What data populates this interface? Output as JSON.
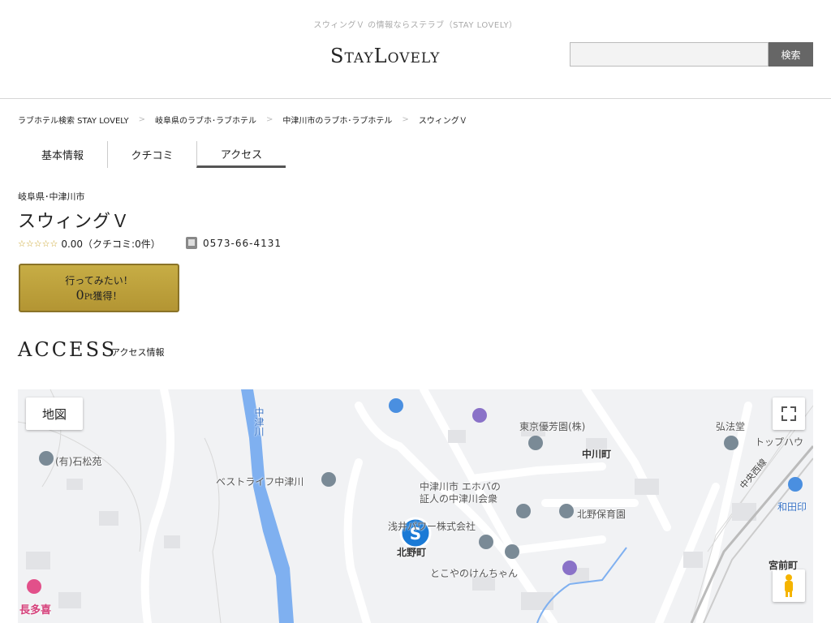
{
  "header": {
    "tagline": "スウィングＶ の情報ならステラブ（STAY LOVELY）",
    "logo": "StayLovely",
    "search_placeholder": "",
    "search_button": "検索"
  },
  "breadcrumb": [
    "ラブホテル検索 STAY LOVELY",
    "岐阜県のラブホ･ラブホテル",
    "中津川市のラブホ･ラブホテル",
    "スウィングＶ"
  ],
  "breadcrumb_separator": ">",
  "tabs": [
    "基本情報",
    "クチコミ",
    "アクセス"
  ],
  "active_tab": "アクセス",
  "hotel": {
    "region": "岐阜県･中津川市",
    "name": "スウィングＶ",
    "stars": "☆☆☆☆☆",
    "rating_text": "0.00（クチコミ:0件）",
    "phone": "0573-66-4131"
  },
  "want_button": {
    "line1": "行ってみたい！",
    "line2_prefix": "0",
    "line2_unit": "Pt",
    "line2_suffix": "獲得！"
  },
  "access": {
    "title": "ACCESS",
    "subtitle": "アクセス情報"
  },
  "map": {
    "type_button": "地図",
    "labels": {
      "ishimatsuen": "(有)石松苑",
      "bestlife": "ベストライフ中津川",
      "tokyo": "東京優芳園(株)",
      "nakagawa": "中川町",
      "kobodo": "弘法堂",
      "top": "トップハウ",
      "chuosen": "中央西線",
      "wada": "和田印",
      "ehoba": "中津川市 エホバの\n証人の中津川会衆",
      "kitano_nursery": "北野保育園",
      "asanuma": "浅井パワー株式会社",
      "kitano": "北野町",
      "tokoya": "とこやのけんちゃん",
      "miyamae": "宮前町",
      "nagata": "長多喜",
      "river": "中津川"
    }
  },
  "colors": {
    "accent_gold": "#c7ad45",
    "map_bg": "#f1f2f4",
    "river": "#7fb0f0",
    "pin_gray": "#7a8a96",
    "brand_blue": "#1a7ad6"
  }
}
